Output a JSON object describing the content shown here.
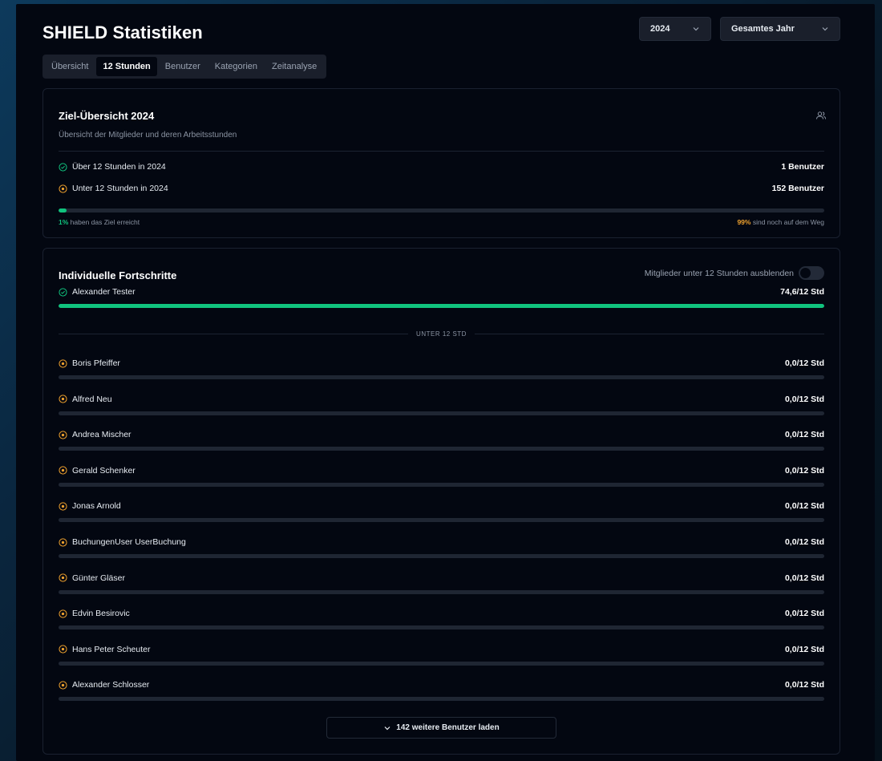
{
  "header": {
    "title": "SHIELD Statistiken",
    "year_select": "2024",
    "range_select": "Gesamtes Jahr"
  },
  "tabs": [
    {
      "label": "Übersicht",
      "active": false
    },
    {
      "label": "12 Stunden",
      "active": true
    },
    {
      "label": "Benutzer",
      "active": false
    },
    {
      "label": "Kategorien",
      "active": false
    },
    {
      "label": "Zeitanalyse",
      "active": false
    }
  ],
  "goal": {
    "title": "Ziel-Übersicht 2024",
    "subtitle": "Übersicht der Mitglieder und deren Arbeitsstunden",
    "above_label": "Über 12 Stunden in 2024",
    "above_value": "1 Benutzer",
    "below_label": "Unter 12 Stunden in 2024",
    "below_value": "152 Benutzer",
    "progress_fraction": 0.01,
    "reached_pct": "1%",
    "reached_text": "haben das Ziel erreicht",
    "remaining_pct": "99%",
    "remaining_text": "sind noch auf dem Weg"
  },
  "progress": {
    "title": "Individuelle Fortschritte",
    "toggle_label": "Mitglieder unter 12 Stunden ausblenden",
    "toggle_on": false,
    "top_member": {
      "name": "Alexander Tester",
      "value": "74,6/12 Std",
      "fraction": 1.0
    },
    "separator_label": "UNTER 12 STD",
    "members": [
      {
        "name": "Boris Pfeiffer",
        "value": "0,0/12 Std",
        "fraction": 0
      },
      {
        "name": "Alfred Neu",
        "value": "0,0/12 Std",
        "fraction": 0
      },
      {
        "name": "Andrea Mischer",
        "value": "0,0/12 Std",
        "fraction": 0
      },
      {
        "name": "Gerald Schenker",
        "value": "0,0/12 Std",
        "fraction": 0
      },
      {
        "name": "Jonas Arnold",
        "value": "0,0/12 Std",
        "fraction": 0
      },
      {
        "name": "BuchungenUser UserBuchung",
        "value": "0,0/12 Std",
        "fraction": 0
      },
      {
        "name": "Günter Gläser",
        "value": "0,0/12 Std",
        "fraction": 0
      },
      {
        "name": "Edvin Besirovic",
        "value": "0,0/12 Std",
        "fraction": 0
      },
      {
        "name": "Hans Peter Scheuter",
        "value": "0,0/12 Std",
        "fraction": 0
      },
      {
        "name": "Alexander Schlosser",
        "value": "0,0/12 Std",
        "fraction": 0
      }
    ],
    "load_more_label": "142 weitere Benutzer laden"
  },
  "colors": {
    "success": "#10c37e",
    "warning": "#f0a22e",
    "background": "#030711"
  },
  "icons": {
    "reached": "check-circle-icon",
    "pending": "clock-circle-icon",
    "users": "users-icon",
    "chevron": "chevron-down-icon"
  }
}
